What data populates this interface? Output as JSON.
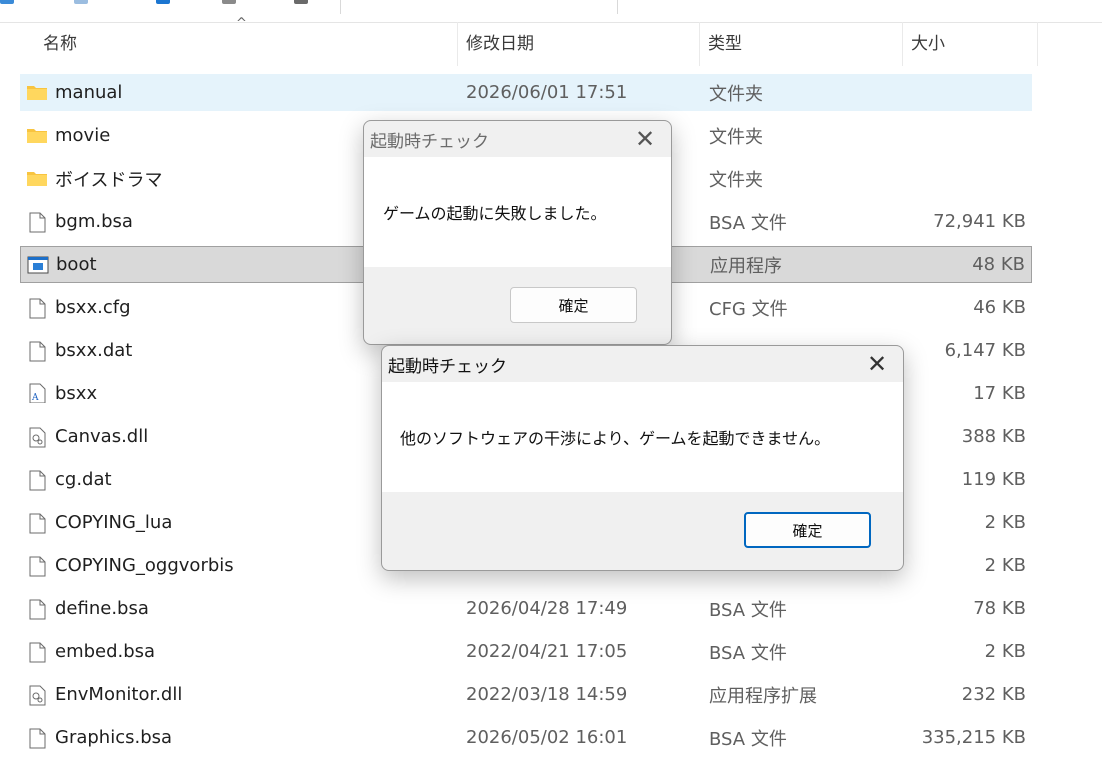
{
  "columns": {
    "name": "名称",
    "date": "修改日期",
    "type": "类型",
    "size": "大小"
  },
  "files": [
    {
      "name": "manual",
      "date": "2026/06/01 17:51",
      "type": "文件夹",
      "size": "",
      "icon": "folder-icon",
      "state": "hover"
    },
    {
      "name": "movie",
      "date": "",
      "type": "文件夹",
      "size": "",
      "icon": "folder-icon",
      "state": ""
    },
    {
      "name": "ボイスドラマ",
      "date": "",
      "type": "文件夹",
      "size": "",
      "icon": "folder-icon",
      "state": ""
    },
    {
      "name": "bgm.bsa",
      "date": "",
      "type": "BSA 文件",
      "size": "72,941 KB",
      "icon": "file-icon",
      "state": ""
    },
    {
      "name": "boot",
      "date": "",
      "type": "应用程序",
      "size": "48 KB",
      "icon": "application-icon",
      "state": "selected"
    },
    {
      "name": "bsxx.cfg",
      "date": "",
      "type": "CFG 文件",
      "size": "46 KB",
      "icon": "file-icon",
      "state": ""
    },
    {
      "name": "bsxx.dat",
      "date": "",
      "type": "",
      "size": "6,147 KB",
      "icon": "file-icon",
      "state": ""
    },
    {
      "name": "bsxx",
      "date": "",
      "type": "",
      "size": "17 KB",
      "icon": "font-file-icon",
      "state": ""
    },
    {
      "name": "Canvas.dll",
      "date": "",
      "type": "",
      "size": "388 KB",
      "icon": "dll-file-icon",
      "state": ""
    },
    {
      "name": "cg.dat",
      "date": "",
      "type": "",
      "size": "119 KB",
      "icon": "file-icon",
      "state": ""
    },
    {
      "name": "COPYING_lua",
      "date": "",
      "type": "",
      "size": "2 KB",
      "icon": "file-icon",
      "state": ""
    },
    {
      "name": "COPYING_oggvorbis",
      "date": "",
      "type": "",
      "size": "2 KB",
      "icon": "file-icon",
      "state": ""
    },
    {
      "name": "define.bsa",
      "date": "2026/04/28 17:49",
      "type": "BSA 文件",
      "size": "78 KB",
      "icon": "file-icon",
      "state": ""
    },
    {
      "name": "embed.bsa",
      "date": "2022/04/21 17:05",
      "type": "BSA 文件",
      "size": "2 KB",
      "icon": "file-icon",
      "state": ""
    },
    {
      "name": "EnvMonitor.dll",
      "date": "2022/03/18 14:59",
      "type": "应用程序扩展",
      "size": "232 KB",
      "icon": "dll-file-icon",
      "state": ""
    },
    {
      "name": "Graphics.bsa",
      "date": "2026/05/02 16:01",
      "type": "BSA 文件",
      "size": "335,215 KB",
      "icon": "file-icon",
      "state": ""
    }
  ],
  "dialog1": {
    "title": "起動時チェック",
    "message": "ゲームの起動に失敗しました。",
    "ok_label": "確定"
  },
  "dialog2": {
    "title": "起動時チェック",
    "message": "他のソフトウェアの干渉により、ゲームを起動できません。",
    "ok_label": "確定"
  },
  "colors": {
    "hover_row": "#e5f3fb",
    "selected_row": "#d9d9d9",
    "folder": "#f8c440",
    "accent": "#0067c0"
  }
}
